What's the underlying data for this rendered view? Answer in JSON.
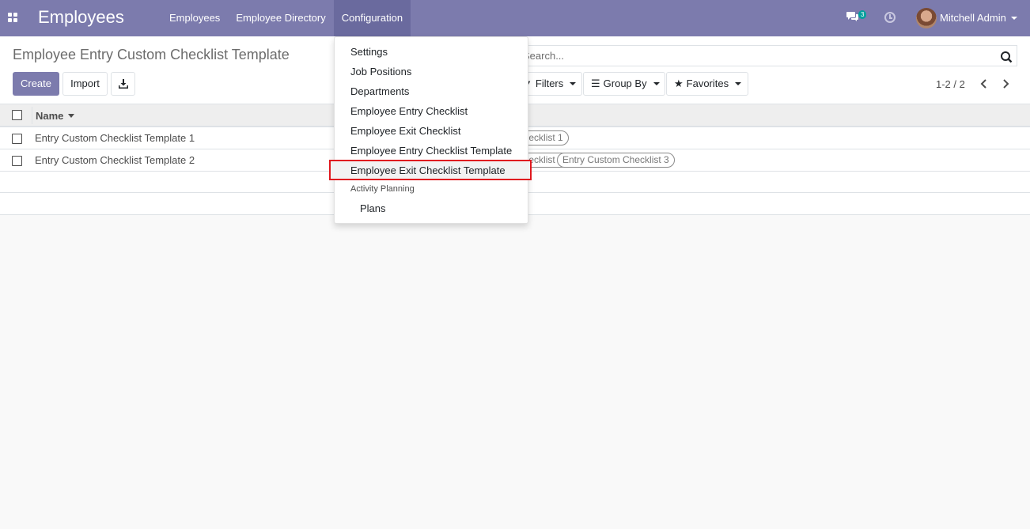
{
  "navbar": {
    "app_name": "Employees",
    "menu": [
      "Employees",
      "Employee Directory",
      "Configuration"
    ],
    "active_menu": "Configuration",
    "chat_count": "3",
    "user_name": "Mitchell Admin"
  },
  "control_panel": {
    "breadcrumb": "Employee Entry Custom Checklist Template",
    "create_label": "Create",
    "import_label": "Import",
    "search_placeholder": "Search...",
    "filters_label": "Filters",
    "group_by_label": "Group By",
    "favorites_label": "Favorites",
    "pager": "1-2 / 2"
  },
  "list": {
    "column_name": "Name",
    "rows": [
      {
        "name": "Entry Custom Checklist Template 1",
        "tags": [
          "Entry Custom Checklist 1"
        ]
      },
      {
        "name": "Entry Custom Checklist Template 2",
        "tags": [
          "Entry Custom Checklist 2",
          "Entry Custom Checklist 3"
        ]
      }
    ]
  },
  "dropdown": {
    "items": [
      "Settings",
      "Job Positions",
      "Departments",
      "Employee Entry Checklist",
      "Employee Exit Checklist",
      "Employee Entry Checklist Template",
      "Employee Exit Checklist Template"
    ],
    "highlighted": "Employee Exit Checklist Template",
    "section_header": "Activity Planning",
    "sub_items": [
      "Plans"
    ]
  },
  "colors": {
    "navbar": "#7c7bad",
    "primary_button": "#7c7bad",
    "highlight_border": "#e0191f",
    "badge": "#00a09d"
  }
}
